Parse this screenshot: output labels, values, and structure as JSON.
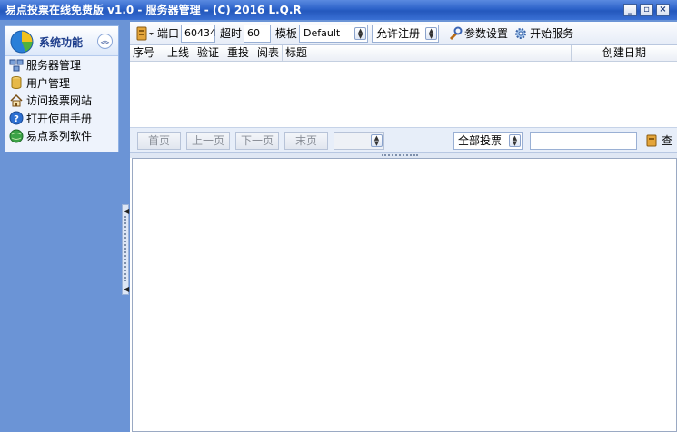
{
  "window": {
    "title": "易点投票在线免费版 v1.0 - 服务器管理 - (C) 2016 L.Q.R",
    "controls": [
      "minimize",
      "restore",
      "close"
    ]
  },
  "sidebar": {
    "title": "系统功能",
    "items": [
      {
        "label": "服务器管理",
        "icon": "server-icon"
      },
      {
        "label": "用户管理",
        "icon": "user-db-icon"
      },
      {
        "label": "访问投票网站",
        "icon": "home-icon"
      },
      {
        "label": "打开使用手册",
        "icon": "help-icon"
      },
      {
        "label": "易点系列软件",
        "icon": "globe-icon"
      }
    ]
  },
  "toolbar": {
    "port_label": "端口",
    "port_value": "60434",
    "timeout_label": "超时",
    "timeout_value": "60",
    "template_label": "模板",
    "template_value": "Default",
    "register_value": "允许注册",
    "settings_label": "参数设置",
    "start_label": "开始服务"
  },
  "table": {
    "columns": [
      "序号",
      "上线",
      "验证",
      "重投",
      "阅表",
      "标题",
      "创建日期"
    ],
    "rows": []
  },
  "pager": {
    "first": "首页",
    "prev": "上一页",
    "next": "下一页",
    "last": "末页",
    "page_select_value": "",
    "filter_value": "全部投票",
    "search_value": "",
    "search_button": "查"
  },
  "colors": {
    "titlebar": "#2d63c9",
    "background": "#6b94d6",
    "sidebar_bg": "#eef3fc"
  }
}
